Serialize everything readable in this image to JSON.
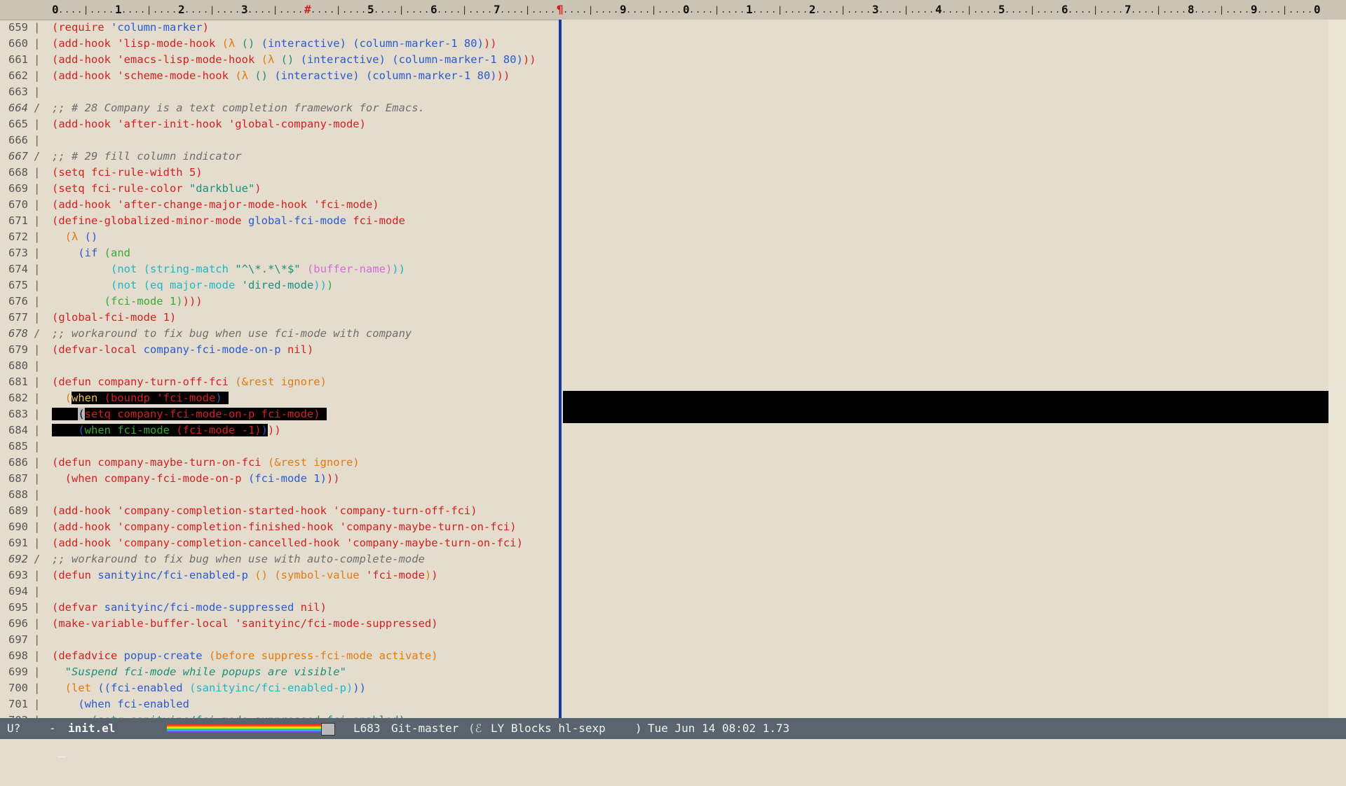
{
  "ruler": {
    "digits": [
      "0",
      "1",
      "2",
      "3",
      "#",
      "5",
      "6",
      "7",
      "¶",
      "9",
      "0",
      "1",
      "2",
      "3",
      "4",
      "5",
      "6",
      "7",
      "8",
      "9",
      "0"
    ]
  },
  "editor": {
    "lines": [
      {
        "n": "659",
        "italic": false,
        "seg": [
          [
            "(require ",
            "#d32020"
          ],
          [
            "'column-marker",
            "#2a5ad1"
          ],
          [
            ")",
            "#d32020"
          ]
        ]
      },
      {
        "n": "660",
        "italic": false,
        "seg": [
          [
            "(add-hook ",
            "#d32020"
          ],
          [
            "'lisp-mode-hook ",
            "#d32020"
          ],
          [
            "(λ ",
            "#e07b10"
          ],
          [
            "() ",
            "#1a8f7a"
          ],
          [
            "(interactive) ",
            "#2a5ad1"
          ],
          [
            "(column-marker-1 80)",
            "#2a5ad1"
          ],
          [
            "))",
            "#d32020"
          ]
        ]
      },
      {
        "n": "661",
        "italic": false,
        "seg": [
          [
            "(add-hook ",
            "#d32020"
          ],
          [
            "'emacs-lisp-mode-hook ",
            "#d32020"
          ],
          [
            "(λ ",
            "#e07b10"
          ],
          [
            "() ",
            "#1a8f7a"
          ],
          [
            "(interactive) ",
            "#2a5ad1"
          ],
          [
            "(column-marker-1 80)",
            "#2a5ad1"
          ],
          [
            "))",
            "#d32020"
          ]
        ]
      },
      {
        "n": "662",
        "italic": false,
        "seg": [
          [
            "(add-hook ",
            "#d32020"
          ],
          [
            "'scheme-mode-hook ",
            "#d32020"
          ],
          [
            "(λ ",
            "#e07b10"
          ],
          [
            "() ",
            "#1a8f7a"
          ],
          [
            "(interactive) ",
            "#2a5ad1"
          ],
          [
            "(column-marker-1 80)",
            "#2a5ad1"
          ],
          [
            "))",
            "#d32020"
          ]
        ]
      },
      {
        "n": "663",
        "italic": false,
        "seg": []
      },
      {
        "n": "664",
        "italic": true,
        "seg": [
          [
            ";; # 28 Company is a text completion framework for Emacs.",
            "#6e6e6e"
          ]
        ]
      },
      {
        "n": "665",
        "italic": false,
        "seg": [
          [
            "(add-hook ",
            "#d32020"
          ],
          [
            "'after-init-hook ",
            "#d32020"
          ],
          [
            "'global-company-mode)",
            "#d32020"
          ]
        ]
      },
      {
        "n": "666",
        "italic": false,
        "seg": []
      },
      {
        "n": "667",
        "italic": true,
        "seg": [
          [
            ";; # 29 fill column indicator",
            "#6e6e6e"
          ]
        ]
      },
      {
        "n": "668",
        "italic": false,
        "seg": [
          [
            "(setq fci-rule-width 5)",
            "#d32020"
          ]
        ]
      },
      {
        "n": "669",
        "italic": false,
        "seg": [
          [
            "(setq fci-rule-color ",
            "#d32020"
          ],
          [
            "\"darkblue\"",
            "#1a8f7a"
          ],
          [
            ")",
            "#d32020"
          ]
        ]
      },
      {
        "n": "670",
        "italic": false,
        "seg": [
          [
            "(add-hook ",
            "#d32020"
          ],
          [
            "'after-change-major-mode-hook ",
            "#d32020"
          ],
          [
            "'fci-mode)",
            "#d32020"
          ]
        ]
      },
      {
        "n": "671",
        "italic": false,
        "seg": [
          [
            "(define-globalized-minor-mode ",
            "#d32020"
          ],
          [
            "global-fci-mode ",
            "#2a5ad1"
          ],
          [
            "fci-mode",
            "#d32020"
          ]
        ]
      },
      {
        "n": "672",
        "italic": false,
        "seg": [
          [
            "  (λ ",
            "#e07b10"
          ],
          [
            "()",
            "#2a5ad1"
          ]
        ]
      },
      {
        "n": "673",
        "italic": false,
        "seg": [
          [
            "    (if ",
            "#2a5ad1"
          ],
          [
            "(and",
            "#38a838"
          ]
        ]
      },
      {
        "n": "674",
        "italic": false,
        "seg": [
          [
            "         (not ",
            "#1fb5c6"
          ],
          [
            "(string-match ",
            "#1fb5c6"
          ],
          [
            "\"^\\*.*\\*$\" ",
            "#1a8f7a"
          ],
          [
            "(buffer-name)",
            "#d56bd8"
          ],
          [
            "))",
            "#1fb5c6"
          ]
        ]
      },
      {
        "n": "675",
        "italic": false,
        "seg": [
          [
            "         (not ",
            "#1fb5c6"
          ],
          [
            "(eq major-mode ",
            "#1fb5c6"
          ],
          [
            "'dired-mode",
            "#1a8f7a"
          ],
          [
            "))",
            "#1fb5c6"
          ],
          [
            ")",
            "#38a838"
          ]
        ]
      },
      {
        "n": "676",
        "italic": false,
        "seg": [
          [
            "        (fci-mode 1)",
            "#38a838"
          ],
          [
            ")))",
            "#d32020"
          ]
        ]
      },
      {
        "n": "677",
        "italic": false,
        "seg": [
          [
            "(global-fci-mode 1)",
            "#d32020"
          ]
        ]
      },
      {
        "n": "678",
        "italic": true,
        "seg": [
          [
            ";; workaround to fix bug when use fci-mode with company",
            "#6e6e6e"
          ]
        ]
      },
      {
        "n": "679",
        "italic": false,
        "seg": [
          [
            "(defvar-local ",
            "#d32020"
          ],
          [
            "company-fci-mode-on-p ",
            "#2a5ad1"
          ],
          [
            "nil)",
            "#d32020"
          ]
        ]
      },
      {
        "n": "680",
        "italic": false,
        "seg": []
      },
      {
        "n": "681",
        "italic": false,
        "seg": [
          [
            "(defun ",
            "#d32020"
          ],
          [
            "company-turn-off-fci ",
            "#d32020"
          ],
          [
            "(&rest ignore)",
            "#e07b10"
          ]
        ]
      },
      {
        "n": "682",
        "italic": false,
        "seg": [
          [
            "  (",
            "#e07b10"
          ],
          [
            "when ",
            "#e8c84a",
            "#000"
          ],
          [
            "(boundp ",
            "#d32020",
            "#000"
          ],
          [
            "'fci-mode",
            "#d32020",
            "#000"
          ],
          [
            ")",
            "#2a5ad1",
            "#000"
          ],
          [
            " ",
            "#000",
            "#000"
          ]
        ]
      },
      {
        "n": "683",
        "italic": false,
        "seg": [
          [
            "    ",
            "#000",
            "#000"
          ],
          [
            "(",
            "#000",
            "#b9b9b9"
          ],
          [
            "setq company-fci-mode-on-p fci-mode)",
            "#d32020",
            "#000"
          ],
          [
            " ",
            "#000",
            "#000"
          ]
        ]
      },
      {
        "n": "684",
        "italic": false,
        "seg": [
          [
            "    (",
            "#2a5ad1",
            "#000"
          ],
          [
            "when fci-mode ",
            "#38a838",
            "#000"
          ],
          [
            "(fci-mode -1)",
            "#d32020",
            "#000"
          ],
          [
            ")",
            "#2a5ad1",
            "#000"
          ],
          [
            "))",
            "#d32020"
          ]
        ]
      },
      {
        "n": "685",
        "italic": false,
        "seg": []
      },
      {
        "n": "686",
        "italic": false,
        "seg": [
          [
            "(defun ",
            "#d32020"
          ],
          [
            "company-maybe-turn-on-fci ",
            "#d32020"
          ],
          [
            "(&rest ignore)",
            "#e07b10"
          ]
        ]
      },
      {
        "n": "687",
        "italic": false,
        "seg": [
          [
            "  (when company-fci-mode-on-p ",
            "#d32020"
          ],
          [
            "(fci-mode 1)",
            "#2a5ad1"
          ],
          [
            "))",
            "#d32020"
          ]
        ]
      },
      {
        "n": "688",
        "italic": false,
        "seg": []
      },
      {
        "n": "689",
        "italic": false,
        "seg": [
          [
            "(add-hook ",
            "#d32020"
          ],
          [
            "'company-completion-started-hook ",
            "#d32020"
          ],
          [
            "'company-turn-off-fci)",
            "#d32020"
          ]
        ]
      },
      {
        "n": "690",
        "italic": false,
        "seg": [
          [
            "(add-hook ",
            "#d32020"
          ],
          [
            "'company-completion-finished-hook ",
            "#d32020"
          ],
          [
            "'company-maybe-turn-on-fci)",
            "#d32020"
          ]
        ]
      },
      {
        "n": "691",
        "italic": false,
        "seg": [
          [
            "(add-hook ",
            "#d32020"
          ],
          [
            "'company-completion-cancelled-hook ",
            "#d32020"
          ],
          [
            "'company-maybe-turn-on-fci)",
            "#d32020"
          ]
        ]
      },
      {
        "n": "692",
        "italic": true,
        "seg": [
          [
            ";; workaround to fix bug when use with auto-complete-mode",
            "#6e6e6e"
          ]
        ]
      },
      {
        "n": "693",
        "italic": false,
        "seg": [
          [
            "(defun ",
            "#d32020"
          ],
          [
            "sanityinc/fci-enabled-p ",
            "#2a5ad1"
          ],
          [
            "() ",
            "#e07b10"
          ],
          [
            "(symbol-value ",
            "#e07b10"
          ],
          [
            "'fci-mode",
            "#d32020"
          ],
          [
            ")",
            "#e07b10"
          ],
          [
            ")",
            "#d32020"
          ]
        ]
      },
      {
        "n": "694",
        "italic": false,
        "seg": []
      },
      {
        "n": "695",
        "italic": false,
        "seg": [
          [
            "(defvar ",
            "#d32020"
          ],
          [
            "sanityinc/fci-mode-suppressed ",
            "#2a5ad1"
          ],
          [
            "nil)",
            "#d32020"
          ]
        ]
      },
      {
        "n": "696",
        "italic": false,
        "seg": [
          [
            "(make-variable-buffer-local ",
            "#d32020"
          ],
          [
            "'sanityinc/fci-mode-suppressed)",
            "#d32020"
          ]
        ]
      },
      {
        "n": "697",
        "italic": false,
        "seg": []
      },
      {
        "n": "698",
        "italic": false,
        "seg": [
          [
            "(defadvice ",
            "#d32020"
          ],
          [
            "popup-create ",
            "#2a5ad1"
          ],
          [
            "(before suppress-fci-mode activate)",
            "#e07b10"
          ]
        ]
      },
      {
        "n": "699",
        "italic": false,
        "seg": [
          [
            "  \"Suspend fci-mode while popups are visible\"",
            "#1a8f7a"
          ]
        ]
      },
      {
        "n": "700",
        "italic": false,
        "seg": [
          [
            "  (let ",
            "#e07b10"
          ],
          [
            "((fci-enabled ",
            "#2a5ad1"
          ],
          [
            "(sanityinc/fci-enabled-p)",
            "#1fb5c6"
          ],
          [
            "))",
            "#2a5ad1"
          ]
        ]
      },
      {
        "n": "701",
        "italic": false,
        "seg": [
          [
            "    (when fci-enabled",
            "#2a5ad1"
          ]
        ]
      },
      {
        "n": "702",
        "italic": false,
        "seg": [
          [
            "      (setq sanityinc/fci-mode-suppressed fci-enabled)",
            "#1a8f7a"
          ]
        ]
      }
    ]
  },
  "modeline": {
    "state": "U?",
    "lock_icon": "padlock-icon",
    "dash": "-",
    "buffer": "init.el",
    "line": "L683",
    "vcs": "Git-master",
    "modes": "LY Blocks hl-sexp",
    "datetime": "Tue Jun 14 08:02 1.73"
  },
  "colors": {
    "background": "#e4ddce",
    "modeline": "#59646f",
    "fill_column": "#1638a8"
  }
}
